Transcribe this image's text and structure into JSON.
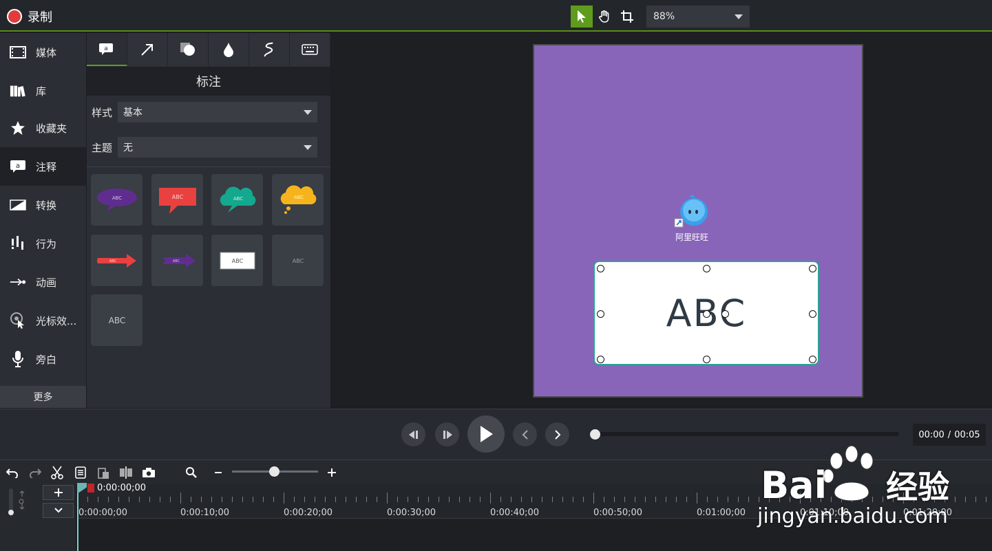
{
  "app": {
    "record_label": "录制"
  },
  "toolbar": {
    "zoom_value": "88%"
  },
  "nav": {
    "items": [
      {
        "label": "媒体",
        "icon": "film-icon"
      },
      {
        "label": "库",
        "icon": "library-icon"
      },
      {
        "label": "收藏夹",
        "icon": "star-icon"
      },
      {
        "label": "注释",
        "icon": "annotation-icon",
        "active": true
      },
      {
        "label": "转换",
        "icon": "transition-icon"
      },
      {
        "label": "行为",
        "icon": "behavior-icon"
      },
      {
        "label": "动画",
        "icon": "animation-icon"
      },
      {
        "label": "光标效...",
        "icon": "cursor-effect-icon"
      },
      {
        "label": "旁白",
        "icon": "microphone-icon"
      }
    ],
    "more_label": "更多"
  },
  "panel": {
    "title": "标注",
    "tabs": [
      "callout-tab-icon",
      "arrow-tab-icon",
      "shape-tab-icon",
      "blur-tab-icon",
      "sketch-tab-icon",
      "keystroke-tab-icon"
    ],
    "style_label": "样式",
    "style_value": "基本",
    "theme_label": "主题",
    "theme_value": "无",
    "tile_text": "ABC"
  },
  "canvas": {
    "desktop_icon_label": "阿里旺旺",
    "callout_text": "ABC",
    "colors": {
      "stage": "#8865b9",
      "callout_border": "#2ba39a",
      "accent": "#5f9b1d"
    }
  },
  "playback": {
    "current": "00:00",
    "separator": "/",
    "total": "00:05"
  },
  "timeline": {
    "playhead_time": "0:00:00;00",
    "ruler_labels": [
      "0:00:00;00",
      "0:00:10;00",
      "0:00:20;00",
      "0:00:30;00",
      "0:00:40;00",
      "0:00:50;00",
      "0:01:00;00",
      "0:01:10;00",
      "0:01:20;00"
    ]
  },
  "watermark": {
    "brand": "Bai",
    "brand_suffix": "经验",
    "url": "jingyan.baidu.com"
  }
}
